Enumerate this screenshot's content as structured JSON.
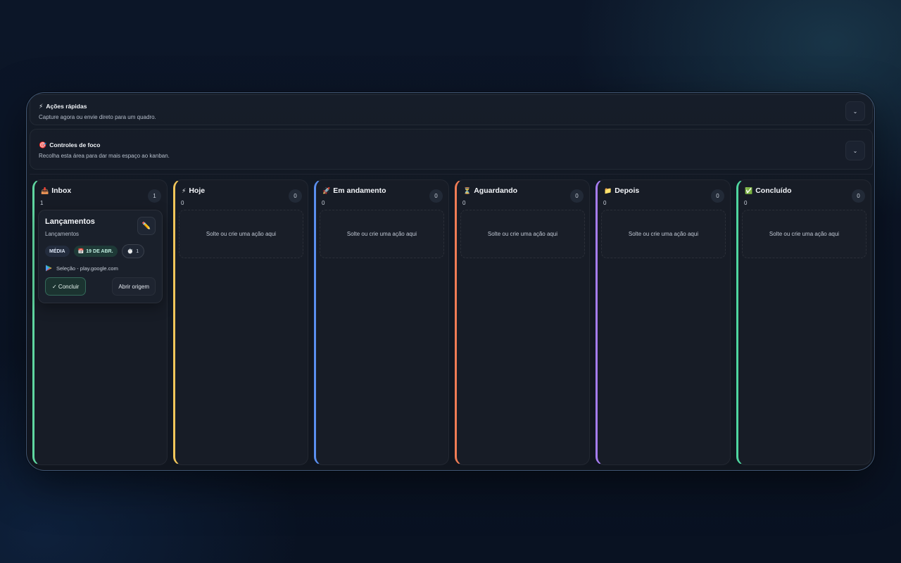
{
  "quick_actions": {
    "icon": "⚡",
    "title": "Ações rápidas",
    "subtitle": "Capture agora ou envie direto para um quadro.",
    "toggle": "⌄"
  },
  "focus_controls": {
    "icon": "🎯",
    "title": "Controles de foco",
    "subtitle": "Recolha esta área para dar mais espaço ao kanban.",
    "toggle": "⌄"
  },
  "columns": [
    {
      "icon": "📥",
      "title": "Inbox",
      "count": "1",
      "badge": "1",
      "accent": "#5fd6a0"
    },
    {
      "icon": "⚡",
      "title": "Hoje",
      "count": "0",
      "badge": "0",
      "accent": "#f1c65a",
      "drop_text": "Solte ou crie uma ação aqui"
    },
    {
      "icon": "🚀",
      "title": "Em andamento",
      "count": "0",
      "badge": "0",
      "accent": "#5b8ff0",
      "drop_text": "Solte ou crie uma ação aqui"
    },
    {
      "icon": "⏳",
      "title": "Aguardando",
      "count": "0",
      "badge": "0",
      "accent": "#f07c55",
      "drop_text": "Solte ou crie uma ação aqui"
    },
    {
      "icon": "📁",
      "title": "Depois",
      "count": "0",
      "badge": "0",
      "accent": "#a57cf0",
      "drop_text": "Solte ou crie uma ação aqui"
    },
    {
      "icon": "✅",
      "title": "Concluído",
      "count": "0",
      "badge": "0",
      "accent": "#4fd6a0",
      "drop_text": "Solte ou crie uma ação aqui"
    }
  ],
  "card": {
    "title": "Lançamentos",
    "subtitle": "Lançamentos",
    "edit_icon": "✏️",
    "priority": "MÉDIA",
    "date_icon": "📅",
    "date": "19 DE ABR.",
    "timer_icon": "⏱️",
    "timer_count": "1",
    "source_icon": "▶",
    "source": "Seleção - play.google.com",
    "complete_button": "✓ Concluir",
    "open_button": "Abrir origem"
  }
}
